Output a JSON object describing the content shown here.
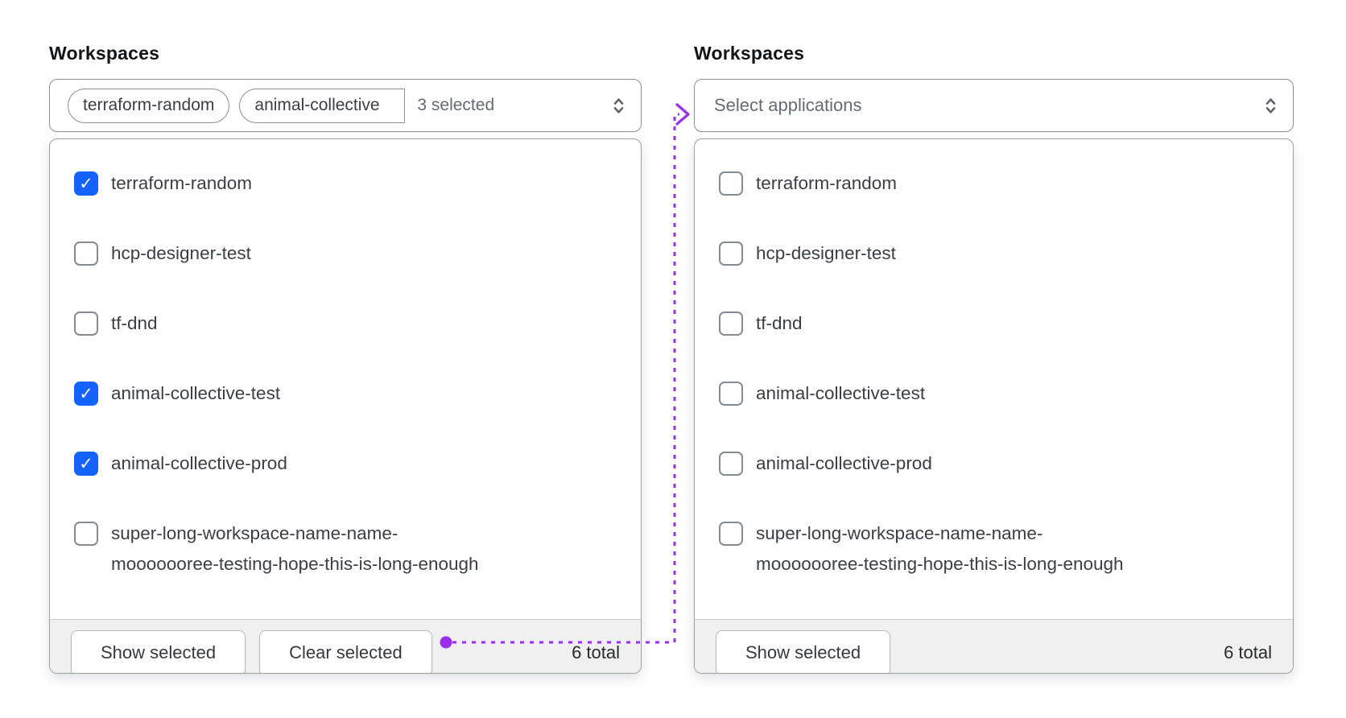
{
  "colors": {
    "checkbox_checked_bg": "#1563ff",
    "connector_purple": "#9b2fe8",
    "footer_bg": "#f0f0f1"
  },
  "left_panel": {
    "label": "Workspaces",
    "trigger": {
      "tags": [
        {
          "label": "terraform-random"
        },
        {
          "label": "animal-collective",
          "truncated": true
        }
      ],
      "count_text": "3 selected",
      "chevron_icon": "chevron-up-down"
    },
    "options": [
      {
        "label": "terraform-random",
        "checked": true
      },
      {
        "label": "hcp-designer-test",
        "checked": false
      },
      {
        "label": "tf-dnd",
        "checked": false
      },
      {
        "label": "animal-collective-test",
        "checked": true
      },
      {
        "label": "animal-collective-prod",
        "checked": true
      },
      {
        "label": "super-long-workspace-name-name-",
        "label_line2": "mooooooree-testing-hope-this-is-long-enough",
        "checked": false
      }
    ],
    "footer": {
      "show_selected_label": "Show selected",
      "clear_selected_label": "Clear selected",
      "total_text": "6 total"
    }
  },
  "right_panel": {
    "label": "Workspaces",
    "trigger": {
      "placeholder": "Select applications",
      "chevron_icon": "chevron-up-down"
    },
    "options": [
      {
        "label": "terraform-random",
        "checked": false
      },
      {
        "label": "hcp-designer-test",
        "checked": false
      },
      {
        "label": "tf-dnd",
        "checked": false
      },
      {
        "label": "animal-collective-test",
        "checked": false
      },
      {
        "label": "animal-collective-prod",
        "checked": false
      },
      {
        "label": "super-long-workspace-name-name-",
        "label_line2": "mooooooree-testing-hope-this-is-long-enough",
        "checked": false
      }
    ],
    "footer": {
      "show_selected_label": "Show selected",
      "total_text": "6 total"
    }
  }
}
